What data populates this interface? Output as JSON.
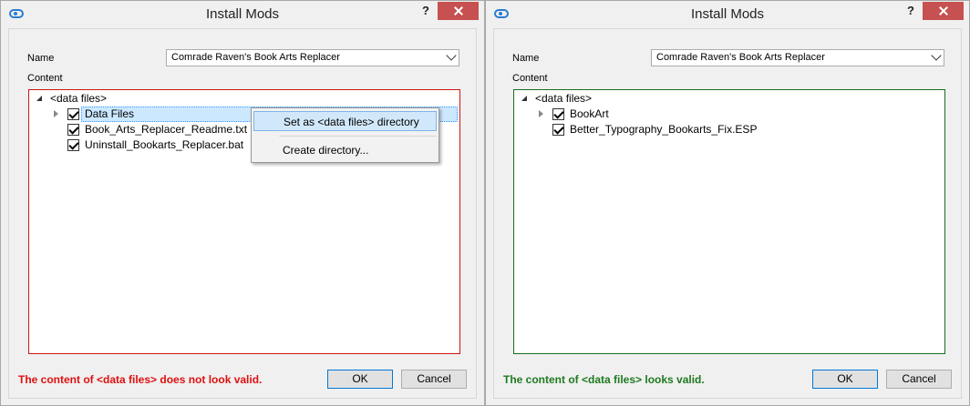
{
  "left_dialog": {
    "title": "Install Mods",
    "help_label": "?",
    "name_label": "Name",
    "name_value": "Comrade Raven's Book Arts Replacer",
    "content_label": "Content",
    "root_node": "<data files>",
    "nodes": [
      {
        "label": "Data Files",
        "checked": true,
        "expandable": true
      },
      {
        "label": "Book_Arts_Replacer_Readme.txt",
        "checked": true,
        "expandable": false
      },
      {
        "label": "Uninstall_Bookarts_Replacer.bat",
        "checked": true,
        "expandable": false
      }
    ],
    "context_menu": {
      "items": [
        "Set as <data files> directory",
        "Create directory..."
      ]
    },
    "status_text": "The content of <data files> does not look valid.",
    "status_color": "#e01010",
    "ok_label": "OK",
    "cancel_label": "Cancel"
  },
  "right_dialog": {
    "title": "Install Mods",
    "help_label": "?",
    "name_label": "Name",
    "name_value": "Comrade Raven's Book Arts Replacer",
    "content_label": "Content",
    "root_node": "<data files>",
    "nodes": [
      {
        "label": "BookArt",
        "checked": true,
        "expandable": true
      },
      {
        "label": "Better_Typography_Bookarts_Fix.ESP",
        "checked": true,
        "expandable": false
      }
    ],
    "status_text": "The content of <data files> looks valid.",
    "status_color": "#1f7a1f",
    "ok_label": "OK",
    "cancel_label": "Cancel"
  }
}
